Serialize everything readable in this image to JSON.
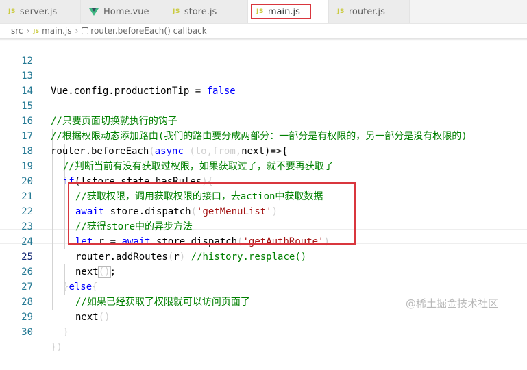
{
  "tabs": [
    {
      "icon": "JS",
      "label": "server.js"
    },
    {
      "icon": "vue",
      "label": "Home.vue"
    },
    {
      "icon": "JS",
      "label": "store.js"
    },
    {
      "icon": "JS",
      "label": "main.js",
      "active": true
    },
    {
      "icon": "JS",
      "label": "router.js"
    }
  ],
  "breadcrumb": {
    "folder": "src",
    "file_icon": "JS",
    "file": "main.js",
    "symbol": "router.beforeEach() callback"
  },
  "lines": [
    {
      "n": "12"
    },
    {
      "n": "13"
    },
    {
      "n": "14"
    },
    {
      "n": "15"
    },
    {
      "n": "16"
    },
    {
      "n": "17"
    },
    {
      "n": "18"
    },
    {
      "n": "19"
    },
    {
      "n": "20"
    },
    {
      "n": "21"
    },
    {
      "n": "22"
    },
    {
      "n": "23"
    },
    {
      "n": "24"
    },
    {
      "n": "25"
    },
    {
      "n": "26"
    },
    {
      "n": "27"
    },
    {
      "n": "28"
    },
    {
      "n": "29"
    },
    {
      "n": "30"
    }
  ],
  "code": {
    "l13_a": "Vue.config.productionTip = ",
    "l13_b": "false",
    "l15": "//只要页面切换就执行的钩子",
    "l16": "//根据权限动态添加路由(我们的路由要分成两部分：一部分是有权限的，另一部分是没有权限的)",
    "l17_a": "router.beforeEach",
    "l17_b": "(",
    "l17_c": "async",
    "l17_d": " (",
    "l17_e": "to",
    "l17_f": ",",
    "l17_g": "from",
    "l17_h": ",",
    "l17_i": "next",
    "l17_j": ")=>{",
    "l18": "//判断当前有没有获取过权限，如果获取过了，就不要再获取了",
    "l19_a": "if",
    "l19_b": "(!store.state.hasRules",
    "l19_c": "){",
    "l20": "//获取权限，调用获取权限的接口，去action中获取数据",
    "l21_a": "await",
    "l21_b": " store.dispatch",
    "l21_c": "(",
    "l21_d": "'getMenuList'",
    "l21_e": ")",
    "l22": "//获得store中的异步方法",
    "l23_a": "let",
    "l23_b": " r = ",
    "l23_c": "await",
    "l23_d": " store.dispatch",
    "l23_e": "(",
    "l23_f": "'getAuthRoute'",
    "l23_g": ")",
    "l24_a": "router.addRoutes",
    "l24_b": "(",
    "l24_c": "r",
    "l24_d": ")",
    "l24_e": " //history.resplace()",
    "l25_a": "next",
    "l25_b": "()",
    "l25_c": ";",
    "l26_a": "}",
    "l26_b": "else",
    "l26_c": "{",
    "l27": "//如果已经获取了权限就可以访问页面了",
    "l28_a": "next",
    "l28_b": "()",
    "l29": "}",
    "l30": "})"
  },
  "watermark": "@稀土掘金技术社区",
  "colors": {
    "keyword": "#0000ff",
    "comment": "#008000",
    "string": "#a31515",
    "line_number": "#237893",
    "annotation_box": "#d9363e"
  }
}
